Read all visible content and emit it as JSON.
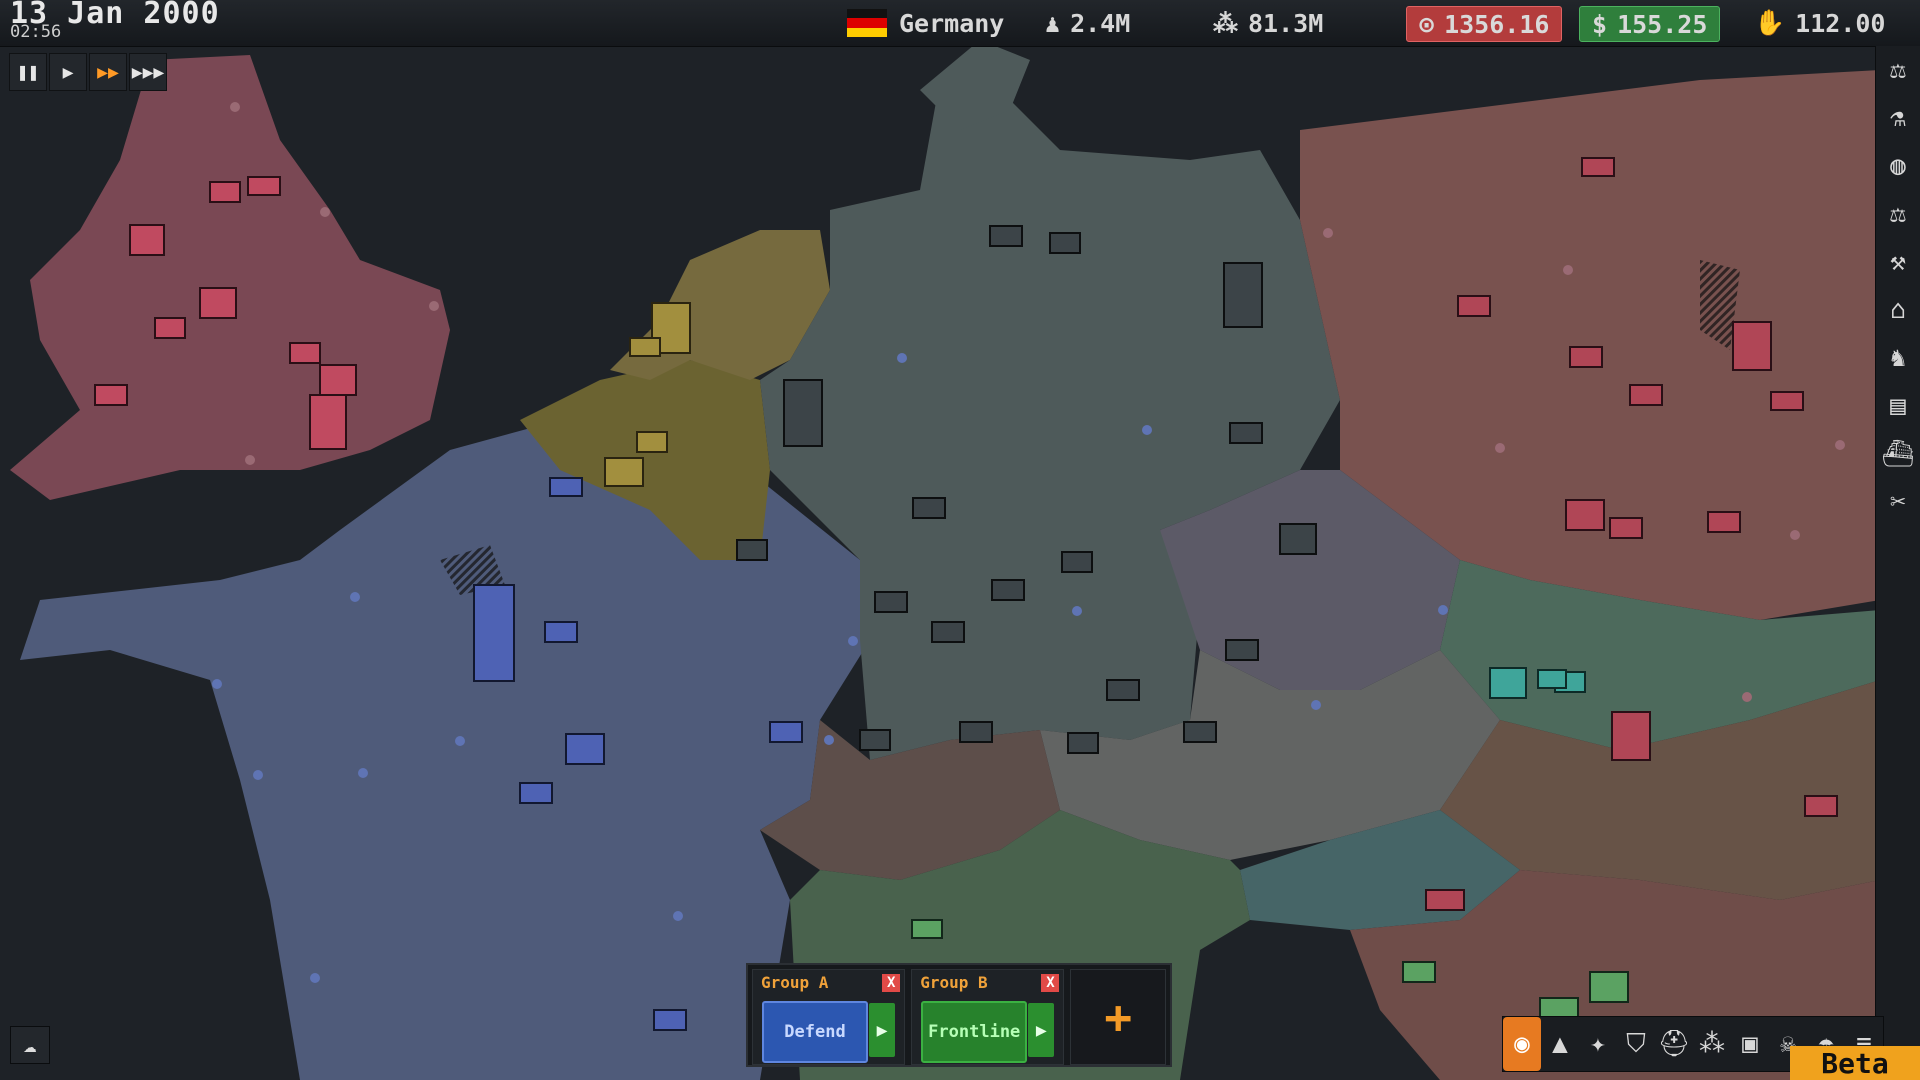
{
  "header": {
    "date": "13 Jan 2000",
    "time": "02:56",
    "country": "Germany",
    "manpower": "2.4M",
    "population": "81.3M",
    "research": "1356.16",
    "money": "155.25",
    "political_power": "112.00"
  },
  "icons": {
    "manpower": "soldier-icon",
    "population": "people-icon",
    "research": "research-icon",
    "money": "dollar-icon",
    "political_power": "hand-icon",
    "speed": [
      "pause-icon",
      "play-icon",
      "fast-forward-icon",
      "fastest-forward-icon"
    ],
    "sidebar": [
      "diplomacy-icon",
      "research-flask-icon",
      "economy-coins-icon",
      "law-scales-icon",
      "production-tools-icon",
      "building-icon",
      "army-soldier-icon",
      "supply-icon",
      "navy-ship-icon",
      "settings-icon"
    ],
    "bottom": [
      "visibility-eye-icon",
      "terrain-mountain-icon",
      "twitter-icon",
      "defense-shield-icon",
      "helmet-icon",
      "population-icon",
      "resource-jar-icon",
      "skull-icon",
      "rain-icon",
      "menu-lines-icon"
    ],
    "chat": "chat-icon"
  },
  "groups": [
    {
      "title": "Group A",
      "mode": "Defend",
      "close": "X"
    },
    {
      "title": "Group B",
      "mode": "Frontline",
      "close": "X"
    }
  ],
  "add_group": "+",
  "badge": "Beta",
  "colors": {
    "uk": "#7f4b56",
    "france": "#4f5b7a",
    "belgium": "#6b6331",
    "netherlands": "#766a3e",
    "germany": "#4e5a5a",
    "poland": "#79524f",
    "czech": "#5c5a67",
    "switzerland": "#5d4e4a",
    "austria": "#626463",
    "slovakia": "#4d6a5c",
    "hungary": "#675347",
    "italy": "#49624d",
    "slovenia": "#466567",
    "croatia": "#6f4d49",
    "sea": "#1e2227",
    "accent": "#e77a21",
    "research_bg": "#b33c3c",
    "money_bg": "#2f7f3c"
  }
}
